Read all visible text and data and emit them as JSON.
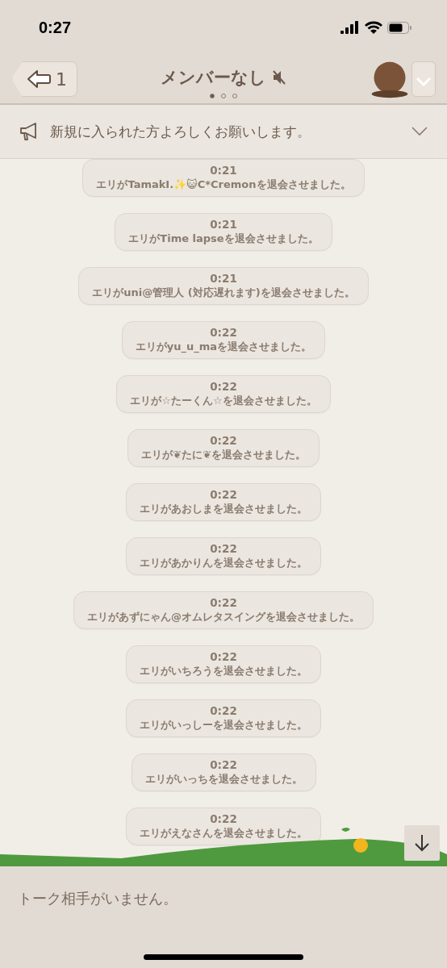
{
  "status_bar": {
    "time": "0:27"
  },
  "header": {
    "back_count": "1",
    "title": "メンバーなし",
    "muted": true,
    "pages": [
      {
        "selected": true
      },
      {
        "selected": false
      },
      {
        "selected": false
      }
    ]
  },
  "announcement": {
    "text": "新規に入られた方よろしくお願いします。"
  },
  "messages": [
    {
      "time": "0:21",
      "text": "エリがTamakI.✨😺C*Cremonを退会させました。"
    },
    {
      "time": "0:21",
      "text": "エリがTime lapseを退会させました。"
    },
    {
      "time": "0:21",
      "text": "エリがuni@管理人 (対応遅れます)を退会させました。"
    },
    {
      "time": "0:22",
      "text": "エリがyu_u_maを退会させました。"
    },
    {
      "time": "0:22",
      "text": "エリが☆たーくん☆を退会させました。"
    },
    {
      "time": "0:22",
      "text": "エリが❦たに❦を退会させました。"
    },
    {
      "time": "0:22",
      "text": "エリがあおしまを退会させました。"
    },
    {
      "time": "0:22",
      "text": "エリがあかりんを退会させました。"
    },
    {
      "time": "0:22",
      "text": "エリがあずにゃん@オムレタスイングを退会させました。"
    },
    {
      "time": "0:22",
      "text": "エリがいちろうを退会させました。"
    },
    {
      "time": "0:22",
      "text": "エリがいっしーを退会させました。"
    },
    {
      "time": "0:22",
      "text": "エリがいっちを退会させました。"
    },
    {
      "time": "0:22",
      "text": "エリがえなさんを退会させました。"
    }
  ],
  "footer": {
    "text": "トーク相手がいません。"
  }
}
